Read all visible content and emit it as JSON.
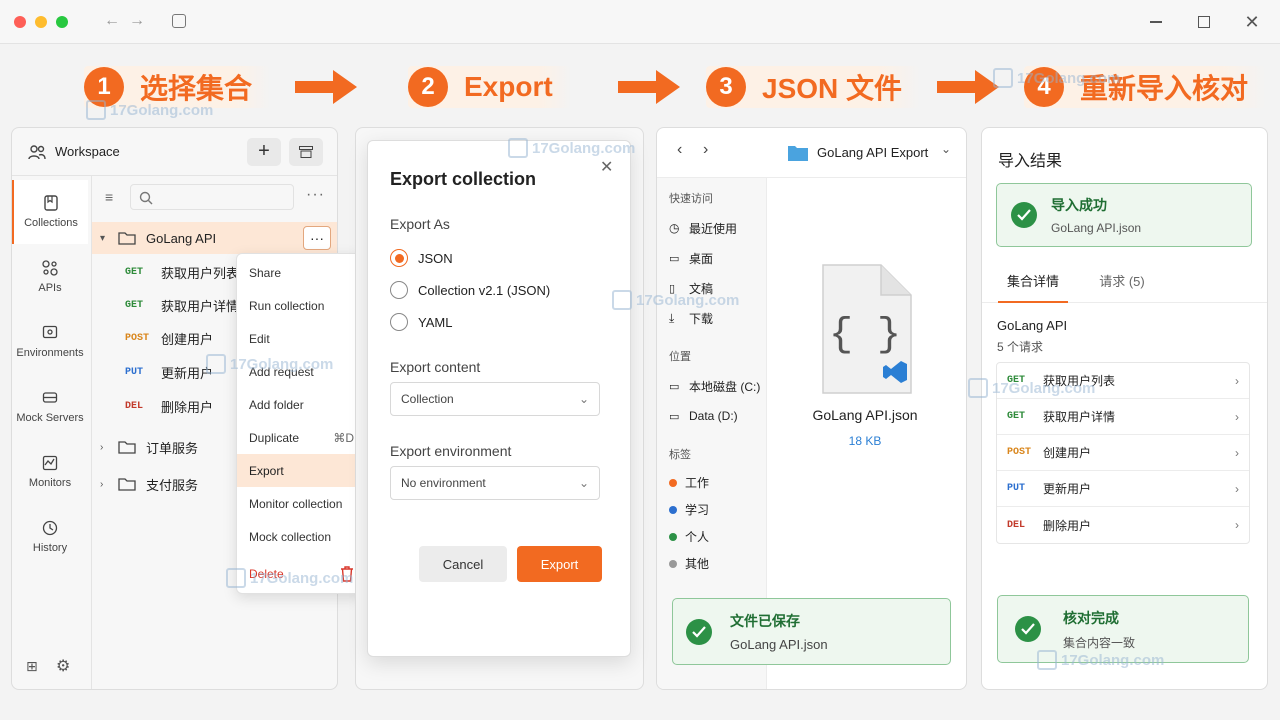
{
  "steps": [
    {
      "num": "1",
      "label": "选择集合"
    },
    {
      "num": "2",
      "label": "Export"
    },
    {
      "num": "3",
      "label": "JSON 文件"
    },
    {
      "num": "4",
      "label": "重新导入核对"
    }
  ],
  "watermark": "17Golang.com",
  "workspace": {
    "title": "Workspace",
    "nav": [
      "Collections",
      "APIs",
      "Environments",
      "Mock Servers",
      "Monitors",
      "History"
    ],
    "collection": "GoLang API",
    "requests": [
      {
        "method": "GET",
        "name": "获取用户列表"
      },
      {
        "method": "GET",
        "name": "获取用户详情"
      },
      {
        "method": "POST",
        "name": "创建用户"
      },
      {
        "method": "PUT",
        "name": "更新用户"
      },
      {
        "method": "DEL",
        "name": "删除用户"
      }
    ],
    "folders": [
      "订单服务",
      "支付服务"
    ]
  },
  "context_menu": {
    "items": [
      "Share",
      "Run collection",
      "Edit",
      "Add request",
      "Add folder",
      "Duplicate",
      "Export",
      "Monitor collection",
      "Mock collection",
      "Delete"
    ],
    "duplicate_shortcut": "⌘D"
  },
  "dialog": {
    "title": "Export collection",
    "export_as_label": "Export As",
    "formats": [
      "JSON",
      "Collection v2.1 (JSON)",
      "YAML"
    ],
    "content_label": "Export content",
    "content_value": "Collection",
    "env_label": "Export environment",
    "env_value": "No environment",
    "cancel": "Cancel",
    "export": "Export"
  },
  "explorer": {
    "folder": "GoLang API Export",
    "quick_access": "快速访问",
    "quick_items": [
      "最近使用",
      "桌面",
      "文稿",
      "下载"
    ],
    "location": "位置",
    "drives": [
      "本地磁盘 (C:)",
      "Data (D:)"
    ],
    "tags_label": "标签",
    "tags": [
      {
        "name": "工作",
        "color": "#f26a21"
      },
      {
        "name": "学习",
        "color": "#2c6fcf"
      },
      {
        "name": "个人",
        "color": "#2c9146"
      },
      {
        "name": "其他",
        "color": "#999999"
      }
    ],
    "file_name": "GoLang API.json",
    "file_size": "18 KB",
    "saved_title": "文件已保存",
    "saved_file": "GoLang API.json"
  },
  "result": {
    "title": "导入结果",
    "success_title": "导入成功",
    "success_file": "GoLang API.json",
    "tabs": [
      "集合详情",
      "请求 (5)"
    ],
    "collection": "GoLang API",
    "count": "5 个请求",
    "requests": [
      {
        "method": "GET",
        "name": "获取用户列表"
      },
      {
        "method": "GET",
        "name": "获取用户详情"
      },
      {
        "method": "POST",
        "name": "创建用户"
      },
      {
        "method": "PUT",
        "name": "更新用户"
      },
      {
        "method": "DEL",
        "name": "删除用户"
      }
    ],
    "verify_title": "核对完成",
    "verify_sub": "集合内容一致"
  },
  "colors": {
    "accent": "#f26a21",
    "success": "#2c9146"
  }
}
